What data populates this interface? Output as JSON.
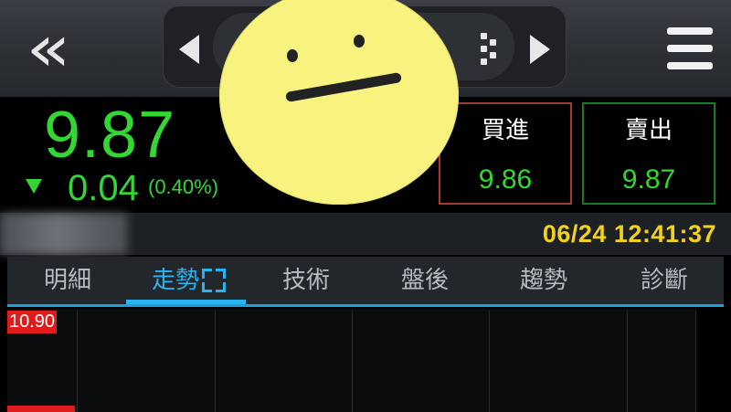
{
  "header": {
    "back_icon": "double-chevron-left-icon",
    "prev_icon": "triangle-left-icon",
    "next_icon": "triangle-right-icon",
    "switch_icon": "dots-grid-icon",
    "menu_icon": "hamburger-menu-icon"
  },
  "quote": {
    "price": "9.87",
    "direction_icon": "triangle-down-icon",
    "change": "0.04",
    "change_pct": "(0.40%)",
    "partial_hidden_value": "63",
    "price_color": "#33d633"
  },
  "orders": {
    "buy_label": "買進",
    "buy_price": "9.86",
    "sell_label": "賣出",
    "sell_price": "9.87"
  },
  "info": {
    "timestamp": "06/24 12:41:37",
    "timestamp_color": "#f2d21b"
  },
  "tabs": [
    {
      "label": "明細",
      "active": false
    },
    {
      "label": "走勢",
      "active": true
    },
    {
      "label": "技術",
      "active": false
    },
    {
      "label": "盤後",
      "active": false
    },
    {
      "label": "趨勢",
      "active": false
    },
    {
      "label": "診斷",
      "active": false
    }
  ],
  "chart": {
    "y_max_label": "10.90",
    "label_color": "#e01b1b"
  },
  "accent_color": "#28b4f0"
}
